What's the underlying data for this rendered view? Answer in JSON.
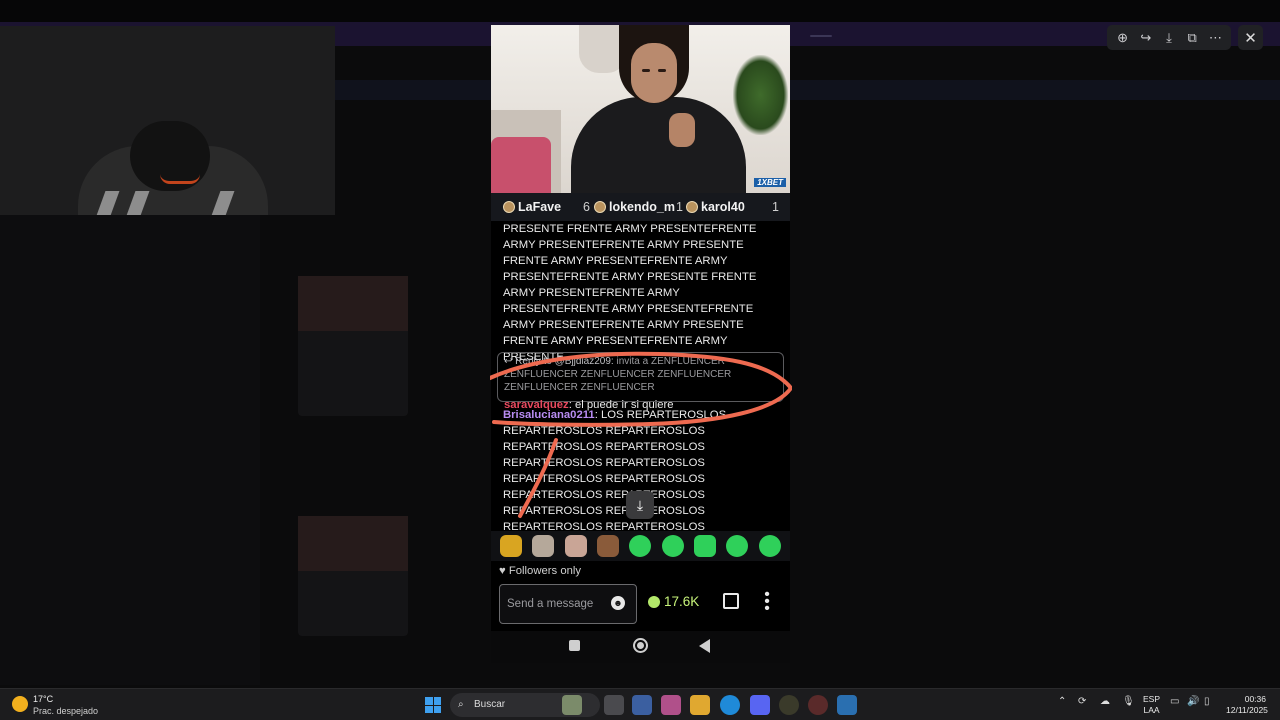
{
  "viewer": {
    "toolbar_icons": [
      "zoom-in-icon",
      "share-icon",
      "download-icon",
      "open-external-icon",
      "more-icon"
    ],
    "close_icon": "close-icon"
  },
  "stream": {
    "leaderboard": [
      {
        "name": "LaFave",
        "count": "6"
      },
      {
        "name": "lokendo_m",
        "count": "1"
      },
      {
        "name": "karol40",
        "count": "1"
      }
    ],
    "overlay_brand": "1XBET",
    "chat": {
      "msg1": "PRESENTE FRENTE ARMY PRESENTEFRENTE ARMY PRESENTEFRENTE ARMY PRESENTE FRENTE ARMY PRESENTEFRENTE ARMY PRESENTEFRENTE ARMY PRESENTE FRENTE ARMY PRESENTEFRENTE ARMY PRESENTEFRENTE ARMY PRESENTEFRENTE ARMY PRESENTEFRENTE ARMY PRESENTE FRENTE ARMY PRESENTEFRENTE ARMY PRESENTE",
      "reply_label": "Reply to @Bjjdiaz209:",
      "reply_text": "invita a ZENFLUENCER ZENFLUENCER ZENFLUENCER ZENFLUENCER ZENFLUENCER ZENFLUENCER",
      "reply_user": "saravalquez",
      "reply_message": "el puede ir si quiere",
      "msg2_user": "Brisaluciana0211",
      "msg2_text": "LOS REPARTEROSLOS REPARTEROSLOS REPARTEROSLOS REPARTEROSLOS REPARTEROSLOS REPARTEROSLOS REPARTEROSLOS REPARTEROSLOS REPARTEROSLOS REPARTEROSLOS REPARTEROSLOS REPARTEROSLOS REPARTEROSLOS REPARTEROSLOS REPARTEROSLOS REPARTEROSLOS REPARTEROSLOS REPARTEROSLOS"
    },
    "followers_only": "Followers only",
    "message_placeholder": "Send a message",
    "points": "17.6K",
    "colors": {
      "points": "#c7f37a",
      "reply_user": "#e84a5f",
      "msg2_user": "#b88cf2",
      "annotation": "#ee6a50"
    }
  },
  "taskbar": {
    "temperature": "17°C",
    "weather": "Prac. despejado",
    "search_label": "Buscar",
    "lang_top": "ESP",
    "lang_bottom": "LAA",
    "time": "00:36",
    "date": "12/11/2025"
  }
}
